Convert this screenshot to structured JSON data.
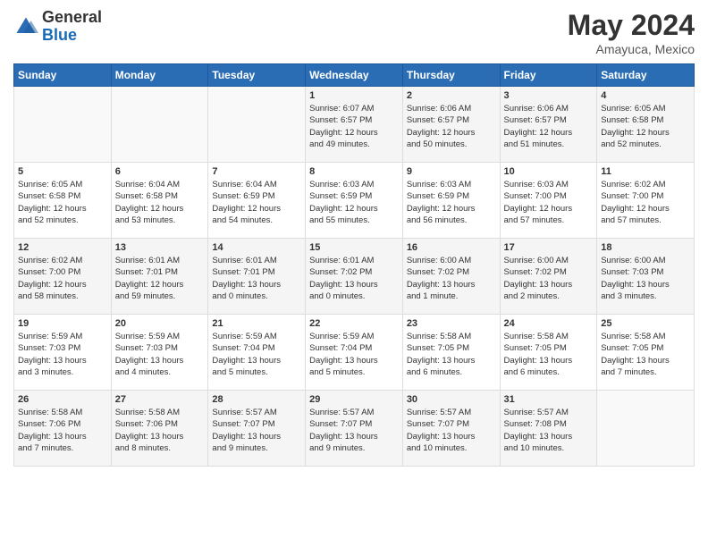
{
  "header": {
    "logo_general": "General",
    "logo_blue": "Blue",
    "month_year": "May 2024",
    "location": "Amayuca, Mexico"
  },
  "weekdays": [
    "Sunday",
    "Monday",
    "Tuesday",
    "Wednesday",
    "Thursday",
    "Friday",
    "Saturday"
  ],
  "weeks": [
    [
      {
        "day": "",
        "info": ""
      },
      {
        "day": "",
        "info": ""
      },
      {
        "day": "",
        "info": ""
      },
      {
        "day": "1",
        "info": "Sunrise: 6:07 AM\nSunset: 6:57 PM\nDaylight: 12 hours\nand 49 minutes."
      },
      {
        "day": "2",
        "info": "Sunrise: 6:06 AM\nSunset: 6:57 PM\nDaylight: 12 hours\nand 50 minutes."
      },
      {
        "day": "3",
        "info": "Sunrise: 6:06 AM\nSunset: 6:57 PM\nDaylight: 12 hours\nand 51 minutes."
      },
      {
        "day": "4",
        "info": "Sunrise: 6:05 AM\nSunset: 6:58 PM\nDaylight: 12 hours\nand 52 minutes."
      }
    ],
    [
      {
        "day": "5",
        "info": "Sunrise: 6:05 AM\nSunset: 6:58 PM\nDaylight: 12 hours\nand 52 minutes."
      },
      {
        "day": "6",
        "info": "Sunrise: 6:04 AM\nSunset: 6:58 PM\nDaylight: 12 hours\nand 53 minutes."
      },
      {
        "day": "7",
        "info": "Sunrise: 6:04 AM\nSunset: 6:59 PM\nDaylight: 12 hours\nand 54 minutes."
      },
      {
        "day": "8",
        "info": "Sunrise: 6:03 AM\nSunset: 6:59 PM\nDaylight: 12 hours\nand 55 minutes."
      },
      {
        "day": "9",
        "info": "Sunrise: 6:03 AM\nSunset: 6:59 PM\nDaylight: 12 hours\nand 56 minutes."
      },
      {
        "day": "10",
        "info": "Sunrise: 6:03 AM\nSunset: 7:00 PM\nDaylight: 12 hours\nand 57 minutes."
      },
      {
        "day": "11",
        "info": "Sunrise: 6:02 AM\nSunset: 7:00 PM\nDaylight: 12 hours\nand 57 minutes."
      }
    ],
    [
      {
        "day": "12",
        "info": "Sunrise: 6:02 AM\nSunset: 7:00 PM\nDaylight: 12 hours\nand 58 minutes."
      },
      {
        "day": "13",
        "info": "Sunrise: 6:01 AM\nSunset: 7:01 PM\nDaylight: 12 hours\nand 59 minutes."
      },
      {
        "day": "14",
        "info": "Sunrise: 6:01 AM\nSunset: 7:01 PM\nDaylight: 13 hours\nand 0 minutes."
      },
      {
        "day": "15",
        "info": "Sunrise: 6:01 AM\nSunset: 7:02 PM\nDaylight: 13 hours\nand 0 minutes."
      },
      {
        "day": "16",
        "info": "Sunrise: 6:00 AM\nSunset: 7:02 PM\nDaylight: 13 hours\nand 1 minute."
      },
      {
        "day": "17",
        "info": "Sunrise: 6:00 AM\nSunset: 7:02 PM\nDaylight: 13 hours\nand 2 minutes."
      },
      {
        "day": "18",
        "info": "Sunrise: 6:00 AM\nSunset: 7:03 PM\nDaylight: 13 hours\nand 3 minutes."
      }
    ],
    [
      {
        "day": "19",
        "info": "Sunrise: 5:59 AM\nSunset: 7:03 PM\nDaylight: 13 hours\nand 3 minutes."
      },
      {
        "day": "20",
        "info": "Sunrise: 5:59 AM\nSunset: 7:03 PM\nDaylight: 13 hours\nand 4 minutes."
      },
      {
        "day": "21",
        "info": "Sunrise: 5:59 AM\nSunset: 7:04 PM\nDaylight: 13 hours\nand 5 minutes."
      },
      {
        "day": "22",
        "info": "Sunrise: 5:59 AM\nSunset: 7:04 PM\nDaylight: 13 hours\nand 5 minutes."
      },
      {
        "day": "23",
        "info": "Sunrise: 5:58 AM\nSunset: 7:05 PM\nDaylight: 13 hours\nand 6 minutes."
      },
      {
        "day": "24",
        "info": "Sunrise: 5:58 AM\nSunset: 7:05 PM\nDaylight: 13 hours\nand 6 minutes."
      },
      {
        "day": "25",
        "info": "Sunrise: 5:58 AM\nSunset: 7:05 PM\nDaylight: 13 hours\nand 7 minutes."
      }
    ],
    [
      {
        "day": "26",
        "info": "Sunrise: 5:58 AM\nSunset: 7:06 PM\nDaylight: 13 hours\nand 7 minutes."
      },
      {
        "day": "27",
        "info": "Sunrise: 5:58 AM\nSunset: 7:06 PM\nDaylight: 13 hours\nand 8 minutes."
      },
      {
        "day": "28",
        "info": "Sunrise: 5:57 AM\nSunset: 7:07 PM\nDaylight: 13 hours\nand 9 minutes."
      },
      {
        "day": "29",
        "info": "Sunrise: 5:57 AM\nSunset: 7:07 PM\nDaylight: 13 hours\nand 9 minutes."
      },
      {
        "day": "30",
        "info": "Sunrise: 5:57 AM\nSunset: 7:07 PM\nDaylight: 13 hours\nand 10 minutes."
      },
      {
        "day": "31",
        "info": "Sunrise: 5:57 AM\nSunset: 7:08 PM\nDaylight: 13 hours\nand 10 minutes."
      },
      {
        "day": "",
        "info": ""
      }
    ]
  ]
}
